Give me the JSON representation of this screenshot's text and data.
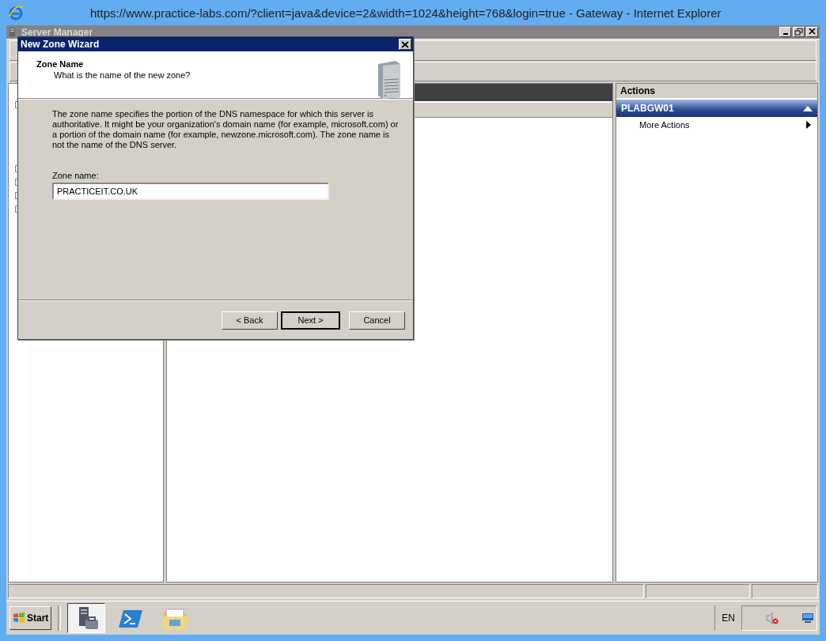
{
  "browser": {
    "title": "https://www.practice-labs.com/?client=java&device=2&width=1024&height=768&login=true - Gateway  - Internet Explorer"
  },
  "app": {
    "title": "Server Manager"
  },
  "actions": {
    "header": "Actions",
    "group": {
      "title": "PLABGW01",
      "expanded": true
    },
    "items": [
      {
        "label": "More Actions"
      }
    ]
  },
  "dialog": {
    "title": "New Zone Wizard",
    "heading": "Zone Name",
    "subheading": "What is the name of the new zone?",
    "description": "The zone name specifies the portion of the DNS namespace for which this server is authoritative. It might be your organization's domain name (for example,  microsoft.com) or a portion of the domain name (for example, newzone.microsoft.com). The zone name is not the name of the DNS server.",
    "field": {
      "label": "Zone name:",
      "value": "PRACTICEIT.CO.UK"
    },
    "buttons": [
      {
        "label": "< Back",
        "default": false
      },
      {
        "label": "Next >",
        "default": true
      },
      {
        "label": "Cancel",
        "default": false
      }
    ]
  },
  "taskbar": {
    "start": "Start",
    "language": "EN"
  }
}
